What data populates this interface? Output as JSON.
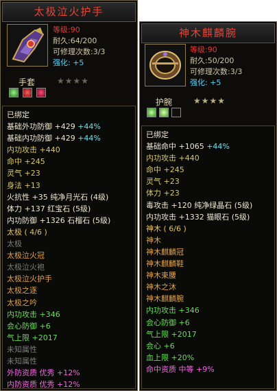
{
  "left": {
    "title": "太极泣火护手",
    "level": "等级:90",
    "durability": "耐久:64/200",
    "repairs": "可修理次数:3/3",
    "enhance": "强化: +5",
    "type": "手套",
    "stars_filled": 0,
    "lines": [
      {
        "t": "已绑定",
        "c": "w"
      },
      {
        "t": "基础外功防御 +429",
        "x": "+44%",
        "c": "w"
      },
      {
        "t": "基础内功防御 +429",
        "x": "+44%",
        "c": "w"
      },
      {
        "t": "内功攻击 +440",
        "c": "y"
      },
      {
        "t": "命中 +245",
        "c": "y"
      },
      {
        "t": "灵气 +23",
        "c": "y"
      },
      {
        "t": "身法 +13",
        "c": "y"
      },
      {
        "t": "火抗性 +35 纯净月光石 (4级)",
        "c": "w"
      },
      {
        "t": "体力 +137 红宝石 (5级)",
        "c": "w"
      },
      {
        "t": "内功防御 +1326 石榴石 (5级)",
        "c": "w"
      },
      {
        "t": "太极 ( 4/6 )",
        "c": "gold"
      },
      {
        "t": "太极",
        "c": "g"
      },
      {
        "t": "太极泣火冠",
        "c": "o"
      },
      {
        "t": "太极泣火袍",
        "c": "g"
      },
      {
        "t": "太极泣火护手",
        "c": "o"
      },
      {
        "t": "太极之逐",
        "c": "o"
      },
      {
        "t": "太极之吟",
        "c": "o"
      },
      {
        "t": "内功攻击 +346",
        "c": "gr"
      },
      {
        "t": "会心防御 +6",
        "c": "gr"
      },
      {
        "t": "气上限 +2017",
        "c": "gr"
      },
      {
        "t": "未知属性",
        "c": "g"
      },
      {
        "t": "未知属性",
        "c": "g"
      },
      {
        "t": "外防资质  优秀 +12%",
        "c": "p"
      },
      {
        "t": "内防资质  优秀 +12%",
        "c": "p"
      }
    ]
  },
  "right": {
    "title": "神木麒麟腕",
    "level": "等级:90",
    "durability": "耐久:50/200",
    "repairs": "可修理次数:3/3",
    "enhance": "强化: +5",
    "type": "护腕",
    "stars_filled": 4,
    "lines": [
      {
        "t": "已绑定",
        "c": "w"
      },
      {
        "t": "基础命中 +1065",
        "x": "+44%",
        "c": "w"
      },
      {
        "t": "内功攻击 +440",
        "c": "y"
      },
      {
        "t": "命中 +245",
        "c": "y"
      },
      {
        "t": "灵气 +23",
        "c": "y"
      },
      {
        "t": "体力 +23",
        "c": "y"
      },
      {
        "t": "毒攻击 +120 纯净绿晶石 (5级)",
        "c": "w"
      },
      {
        "t": "内功攻击 +1332 猫眼石 (5级)",
        "c": "w"
      },
      {
        "t": "神木 ( 6/6 )",
        "c": "gold"
      },
      {
        "t": "神木",
        "c": "o"
      },
      {
        "t": "神木麒麟冠",
        "c": "o"
      },
      {
        "t": "神木麒麟鞋",
        "c": "o"
      },
      {
        "t": "神木束腰",
        "c": "o"
      },
      {
        "t": "神木之沐",
        "c": "o"
      },
      {
        "t": "神木麒麟腕",
        "c": "o"
      },
      {
        "t": "内功攻击 +346",
        "c": "gr"
      },
      {
        "t": "会心防御 +6",
        "c": "gr"
      },
      {
        "t": "气上限 +2017",
        "c": "gr"
      },
      {
        "t": "会心 +6",
        "c": "gr"
      },
      {
        "t": "血上限 +20%",
        "c": "gr"
      },
      {
        "t": "命中资质  中等 +9%",
        "c": "p"
      }
    ]
  }
}
